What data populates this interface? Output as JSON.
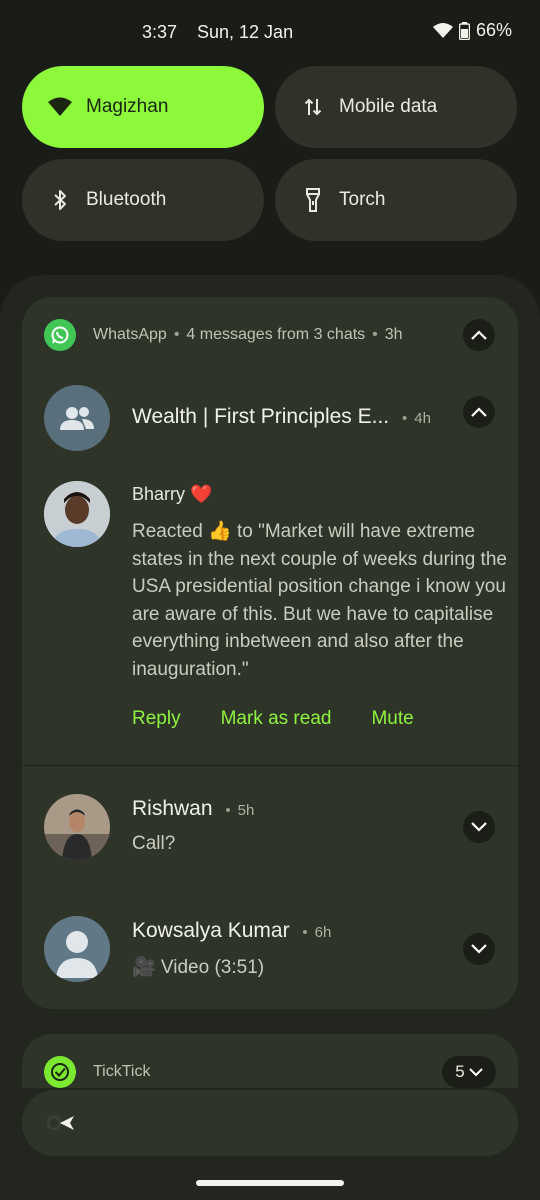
{
  "status": {
    "time": "3:37",
    "date": "Sun, 12 Jan",
    "battery": "66%"
  },
  "tiles": [
    {
      "label": "Magizhan",
      "icon": "wifi-icon",
      "active": true
    },
    {
      "label": "Mobile data",
      "icon": "mobile-data-icon",
      "active": false
    },
    {
      "label": "Bluetooth",
      "icon": "bluetooth-icon",
      "active": false
    },
    {
      "label": "Torch",
      "icon": "torch-icon",
      "active": false
    }
  ],
  "whatsapp": {
    "app_name": "WhatsApp",
    "summary": "4 messages from 3 chats",
    "time": "3h",
    "group": {
      "title": "Wealth | First Principles E...",
      "time": "4h",
      "sender": "Bharry ❤️",
      "message": "Reacted 👍 to \"Market will have extreme states in the next couple of weeks during the USA presidential position change i know you are aware of this. But we have to capitalise everything inbetween and also after the inauguration.\"",
      "actions": [
        "Reply",
        "Mark as read",
        "Mute"
      ]
    },
    "chats": [
      {
        "name": "Rishwan",
        "time": "5h",
        "message": "Call?"
      },
      {
        "name": "Kowsalya Kumar",
        "time": "6h",
        "message": "🎥 Video (3:51)"
      }
    ]
  },
  "ticktick": {
    "app_name": "TickTick",
    "count": "5"
  },
  "colors": {
    "accent": "#8cf93a",
    "whatsapp": "#41c755"
  }
}
